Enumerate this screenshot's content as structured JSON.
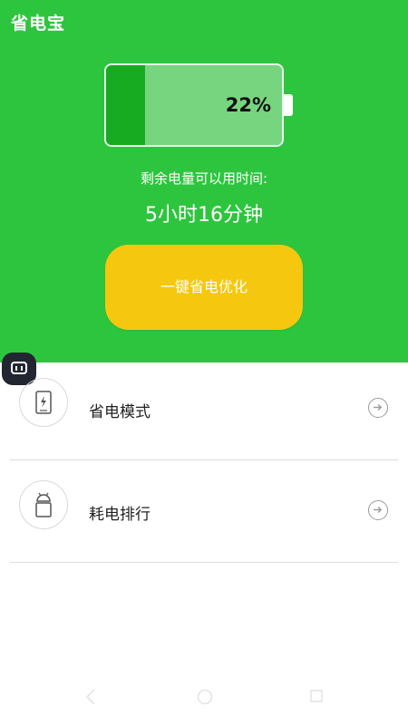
{
  "app": {
    "title": "省电宝"
  },
  "battery": {
    "percent_text": "22%",
    "level_fraction": 0.22
  },
  "remaining": {
    "label": "剩余电量可以用时间:",
    "value": "5小时16分钟"
  },
  "optimize_button": {
    "label": "一键省电优化"
  },
  "menu": {
    "items": [
      {
        "label": "省电模式",
        "icon": "phone-bolt-icon"
      },
      {
        "label": "耗电排行",
        "icon": "android-icon"
      }
    ]
  },
  "colors": {
    "header_bg": "#2ec53e",
    "battery_fill": "#17ab22",
    "battery_remaining": "#77d57f",
    "button_bg": "#f5c80f"
  },
  "nav_icons": [
    "back-icon",
    "home-icon",
    "recent-apps-icon"
  ]
}
